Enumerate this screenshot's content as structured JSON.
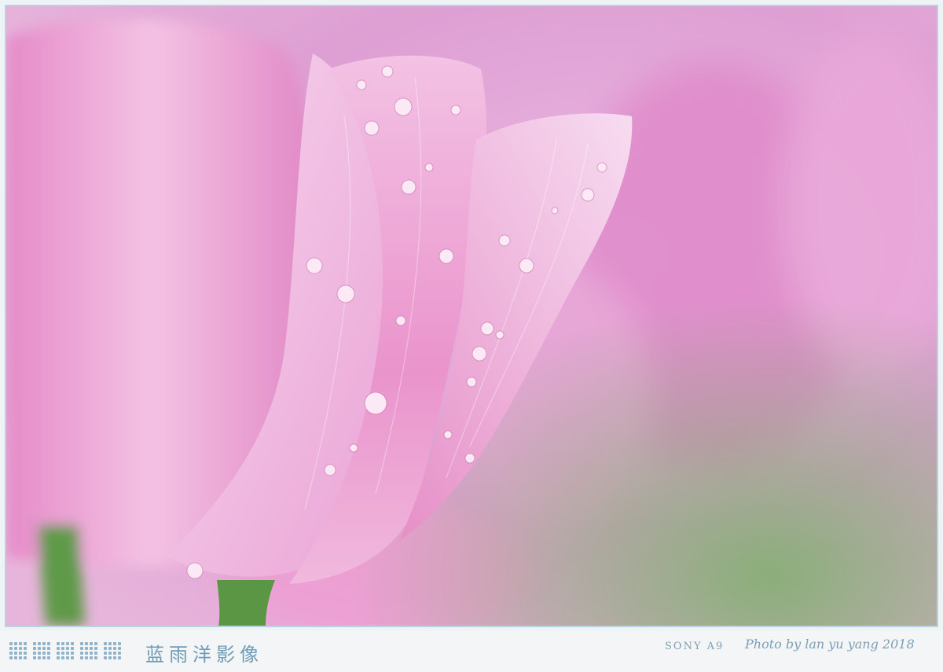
{
  "watermark": {
    "studio_name": "蓝雨洋影像",
    "camera": "SONY A9",
    "credit": "Photo by lan yu yang 2018"
  },
  "photo": {
    "subject": "pink-tulip-with-water-droplets",
    "palette": {
      "background": "#e8b6de",
      "petal_light": "#f5d3ea",
      "petal_deep": "#e27fc0",
      "stem_green": "#5e9a4a",
      "border": "#b9d2e2",
      "watermark_text": "#7c9fb5"
    }
  }
}
